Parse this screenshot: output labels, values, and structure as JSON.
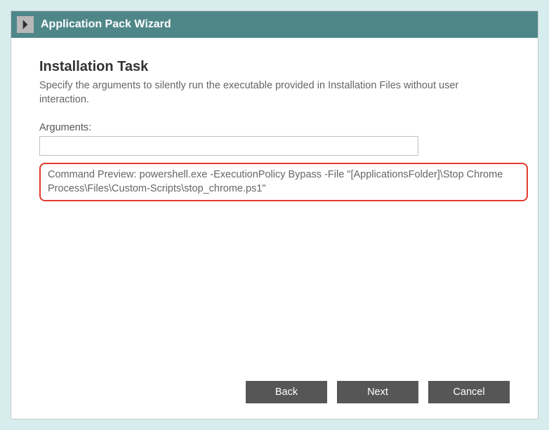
{
  "titleBar": {
    "title": "Application Pack Wizard"
  },
  "page": {
    "heading": "Installation Task",
    "description": "Specify the arguments to silently run the executable provided in Installation Files without user interaction."
  },
  "arguments": {
    "label": "Arguments:",
    "value": ""
  },
  "commandPreview": {
    "text": "Command Preview: powershell.exe -ExecutionPolicy Bypass -File \"[ApplicationsFolder]\\Stop Chrome Process\\Files\\Custom-Scripts\\stop_chrome.ps1\""
  },
  "buttons": {
    "back": "Back",
    "next": "Next",
    "cancel": "Cancel"
  }
}
